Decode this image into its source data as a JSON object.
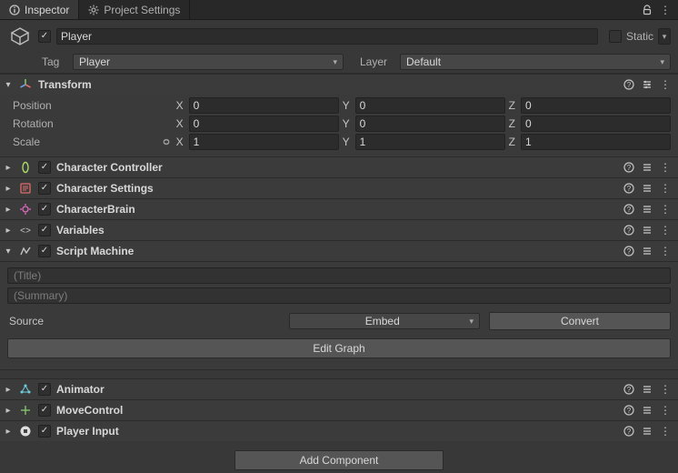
{
  "tabs": {
    "inspector": "Inspector",
    "project_settings": "Project Settings"
  },
  "header": {
    "name": "Player",
    "static_label": "Static",
    "tag_label": "Tag",
    "tag_value": "Player",
    "layer_label": "Layer",
    "layer_value": "Default"
  },
  "transform": {
    "title": "Transform",
    "position_label": "Position",
    "rotation_label": "Rotation",
    "scale_label": "Scale",
    "pos": {
      "x": "0",
      "y": "0",
      "z": "0"
    },
    "rot": {
      "x": "0",
      "y": "0",
      "z": "0"
    },
    "scale": {
      "x": "1",
      "y": "1",
      "z": "1"
    },
    "axis": {
      "x": "X",
      "y": "Y",
      "z": "Z"
    }
  },
  "components": {
    "char_controller": "Character Controller",
    "char_settings": "Character Settings",
    "char_brain": "CharacterBrain",
    "variables": "Variables",
    "script_machine": "Script Machine",
    "animator": "Animator",
    "move_control": "MoveControl",
    "player_input": "Player Input"
  },
  "script_machine": {
    "title_placeholder": "(Title)",
    "summary_placeholder": "(Summary)",
    "source_label": "Source",
    "source_value": "Embed",
    "convert_label": "Convert",
    "edit_graph_label": "Edit Graph"
  },
  "add_component_label": "Add Component",
  "glyphs": {
    "check": "✓",
    "caret_down": "▾",
    "caret_right": "▸",
    "dots": "⋮",
    "lock": "🔓",
    "help": "?",
    "sliders": "⇄",
    "link": "⧉",
    "diamond": "◇"
  }
}
